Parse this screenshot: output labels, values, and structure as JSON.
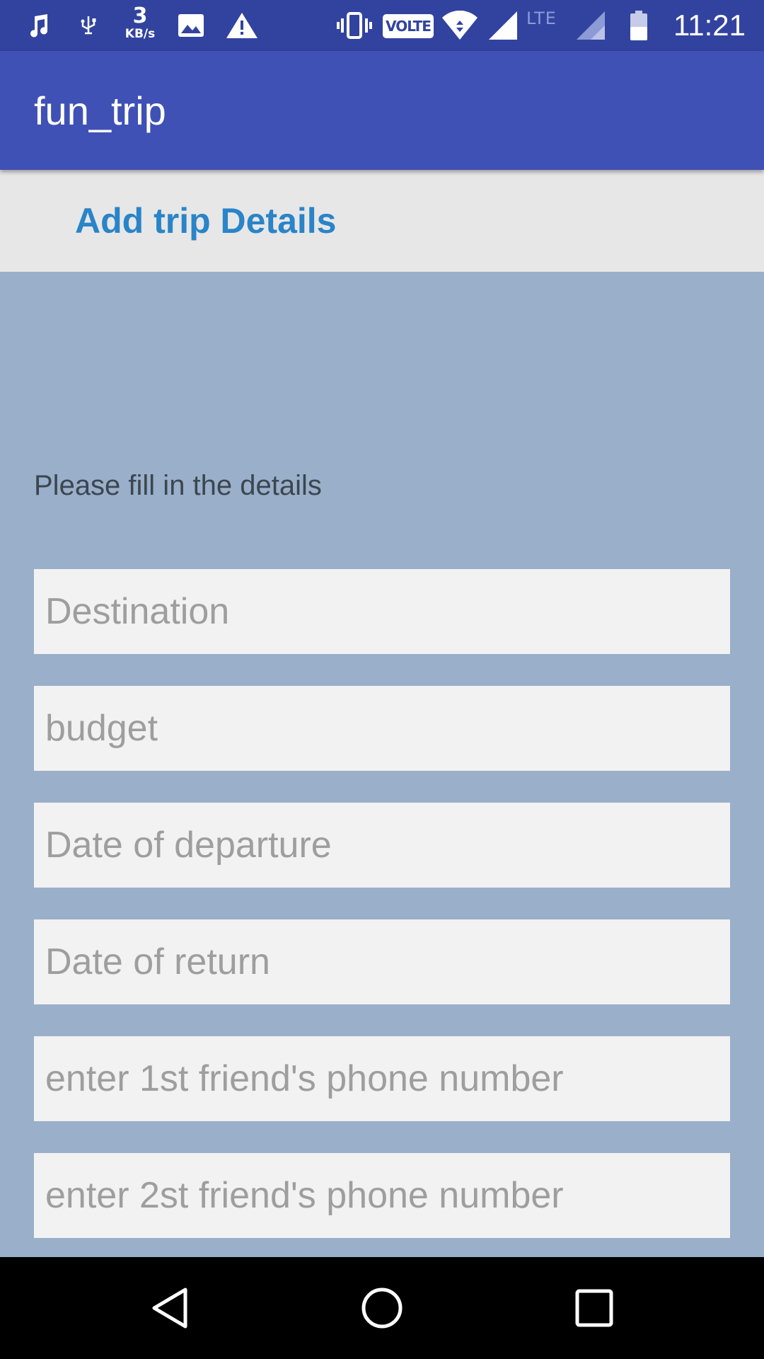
{
  "status_bar": {
    "icons": [
      "music-note-icon",
      "usb-debug-icon",
      "image-icon",
      "warning-icon",
      "vibrate-icon",
      "wifi-icon",
      "signal-icon",
      "signal-icon",
      "battery-icon"
    ],
    "speed_value": "3",
    "speed_unit": "KB/s",
    "volte": "VOLTE",
    "lte": "LTE",
    "time": "11:21"
  },
  "app_bar": {
    "title": "fun_trip"
  },
  "header": {
    "title": "Add trip Details"
  },
  "form": {
    "instruction": "Please fill in the details",
    "destination_placeholder": "Destination",
    "budget_placeholder": "budget",
    "departure_placeholder": "Date of departure",
    "return_placeholder": "Date of return",
    "friend1_placeholder": "enter 1st friend's phone number",
    "friend2_placeholder": "enter 2st friend's phone number"
  },
  "nav_bar": {
    "icons": [
      "back-icon",
      "home-icon",
      "recents-icon"
    ]
  },
  "colors": {
    "status_bar": "#32439f",
    "app_bar": "#3f51b5",
    "header_band": "#e7e7e7",
    "header_title": "#2a84c8",
    "page_background": "#9aafc9",
    "field_background": "#f2f2f2"
  }
}
